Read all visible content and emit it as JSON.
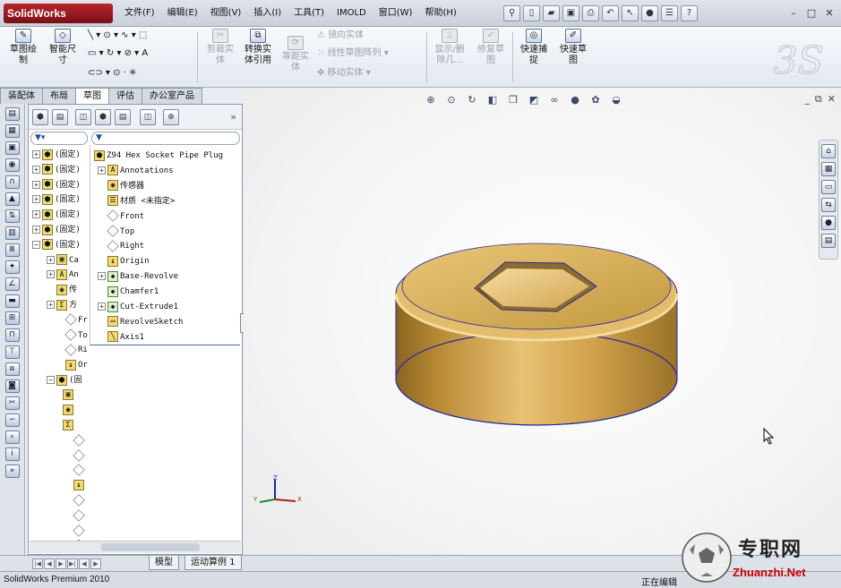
{
  "app": {
    "logo_text": "SolidWorks"
  },
  "menu": [
    "文件(F)",
    "编辑(E)",
    "视图(V)",
    "插入(I)",
    "工具(T)",
    "IMOLD",
    "窗口(W)",
    "帮助(H)"
  ],
  "ribbon": {
    "sketch": "草图绘\n制",
    "smart_dim": "智能尺\n寸",
    "trim": "剪裁实\n体",
    "convert": "转换实\n体引用",
    "offset": "等距实\n体",
    "mirror": "镜向实体",
    "linear_pattern": "线性草图阵列",
    "move": "移动实体",
    "show_delete": "显示/删\n除几...",
    "repair": "修复草\n图",
    "quick_snap": "快速捕\n捉",
    "rapid_sketch": "快速草\n图"
  },
  "tabs": [
    "装配体",
    "布局",
    "草图",
    "评估",
    "办公室产品"
  ],
  "active_tab_index": 2,
  "tree_left": [
    {
      "label": "(固定)",
      "icon": "part"
    },
    {
      "label": "(固定)",
      "icon": "part"
    },
    {
      "label": "(固定)",
      "icon": "part"
    },
    {
      "label": "(固定)",
      "icon": "part"
    },
    {
      "label": "(固定)",
      "icon": "part"
    },
    {
      "label": "(固定)",
      "icon": "part"
    },
    {
      "label": "(固定)",
      "icon": "part"
    },
    {
      "label": "Ca",
      "icon": "folder"
    },
    {
      "label": "An",
      "icon": "annot"
    },
    {
      "label": "传",
      "icon": "sensor"
    },
    {
      "label": "方",
      "icon": "equation"
    },
    {
      "label": "Fr",
      "icon": "plane"
    },
    {
      "label": "To",
      "icon": "plane"
    },
    {
      "label": "Ri",
      "icon": "plane"
    },
    {
      "label": "Or",
      "icon": "origin"
    },
    {
      "label": "(固",
      "icon": "part"
    }
  ],
  "popup_tree": [
    {
      "label": "Z94 Hex Socket Pipe Plug",
      "icon": "part"
    },
    {
      "label": "Annotations",
      "icon": "annot"
    },
    {
      "label": "传感器",
      "icon": "sensor"
    },
    {
      "label": "材质 <未指定>",
      "icon": "material"
    },
    {
      "label": "Front",
      "icon": "plane"
    },
    {
      "label": "Top",
      "icon": "plane"
    },
    {
      "label": "Right",
      "icon": "plane"
    },
    {
      "label": "Origin",
      "icon": "origin"
    },
    {
      "label": "Base-Revolve",
      "icon": "feature"
    },
    {
      "label": "Chamfer1",
      "icon": "feature"
    },
    {
      "label": "Cut-Extrude1",
      "icon": "feature"
    },
    {
      "label": "RevolveSketch",
      "icon": "sketch"
    },
    {
      "label": "Axis1",
      "icon": "axis"
    }
  ],
  "bottom_tabs": [
    "模型",
    "运动算例 1"
  ],
  "status": {
    "left": "SolidWorks Premium 2010",
    "right": "正在编辑"
  },
  "watermark": {
    "text": "专职网",
    "url": "Zhuanzhi.Net"
  },
  "colors": {
    "part_gold": "#c9a04a",
    "part_edge": "#2a2aa0"
  }
}
